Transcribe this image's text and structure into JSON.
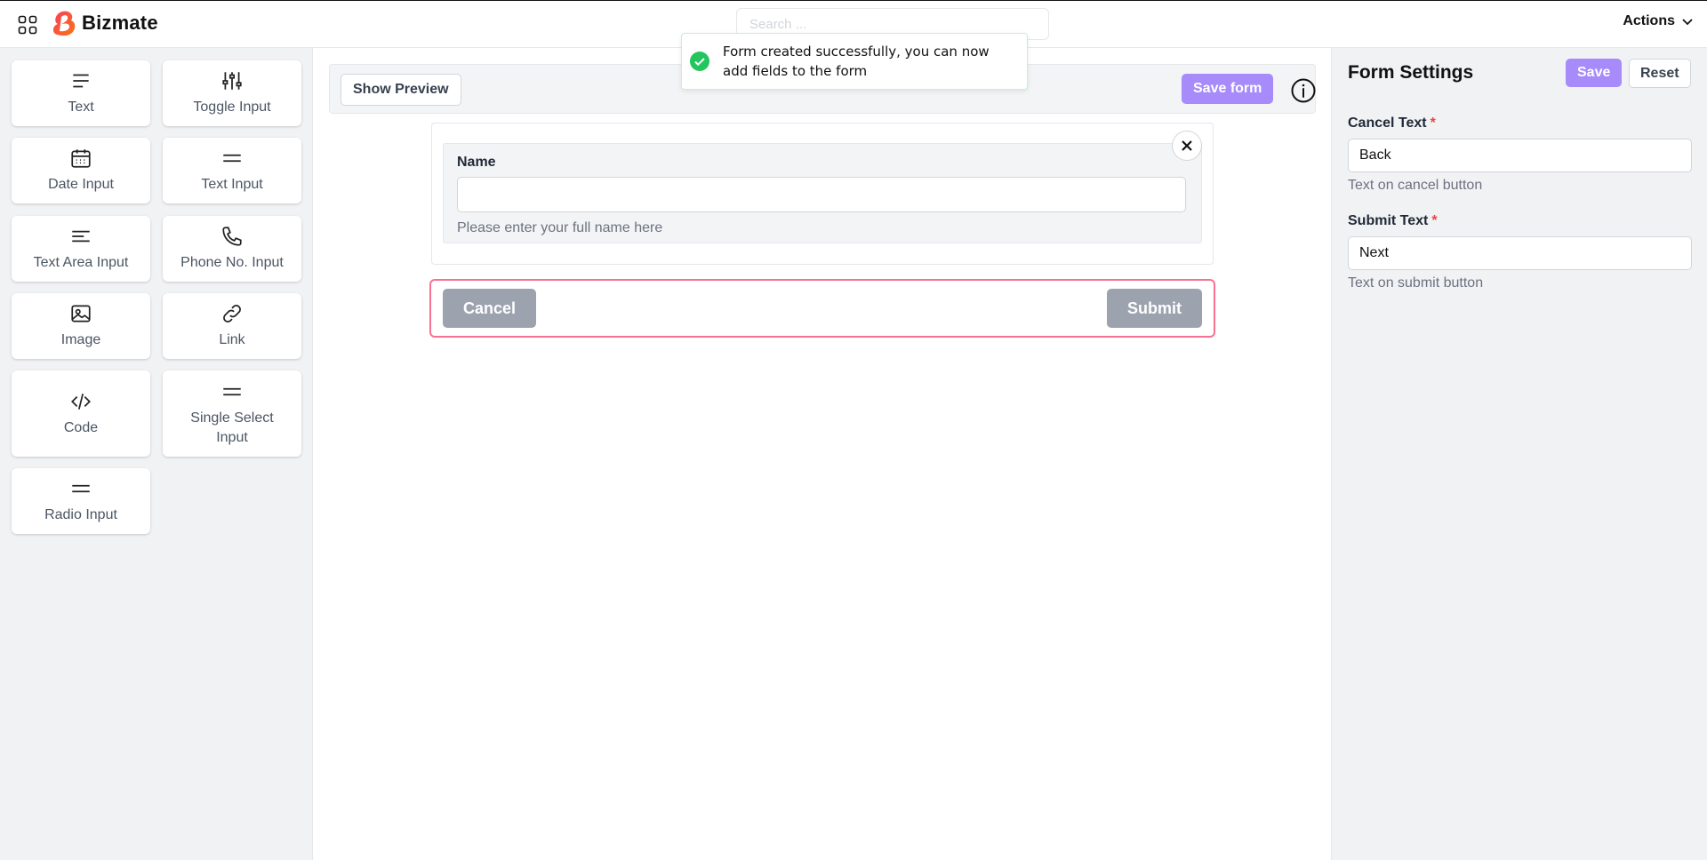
{
  "header": {
    "brand_name": "Bizmate",
    "search_placeholder": "Search ...",
    "actions_label": "Actions",
    "brand_color": "#f97316"
  },
  "palette": {
    "items": [
      {
        "label": "Text",
        "icon": "text-lines-icon"
      },
      {
        "label": "Toggle Input",
        "icon": "sliders-icon"
      },
      {
        "label": "Date Input",
        "icon": "calendar-icon"
      },
      {
        "label": "Text Input",
        "icon": "equals-lines-icon"
      },
      {
        "label": "Text Area Input",
        "icon": "align-left-icon"
      },
      {
        "label": "Phone No. Input",
        "icon": "phone-icon"
      },
      {
        "label": "Image",
        "icon": "image-icon"
      },
      {
        "label": "Link",
        "icon": "link-icon"
      },
      {
        "label": "Code",
        "icon": "code-icon"
      },
      {
        "label": "Single Select Input",
        "icon": "equals-lines-icon"
      },
      {
        "label": "Radio Input",
        "icon": "equals-lines-icon"
      }
    ]
  },
  "canvas": {
    "show_preview_label": "Show Preview",
    "save_form_label": "Save form",
    "field": {
      "label": "Name",
      "value": "",
      "help_text": "Please enter your full name here"
    },
    "cancel_label": "Cancel",
    "submit_label": "Submit",
    "accent_color": "#a78bfa",
    "selection_border_color": "#f87191"
  },
  "toast": {
    "message": "Form created successfully, you can now add fields to the form",
    "status_color": "#22c55e"
  },
  "settings": {
    "title": "Form Settings",
    "save_label": "Save",
    "reset_label": "Reset",
    "cancel_text_label": "Cancel Text",
    "cancel_text_value": "Back",
    "cancel_text_help": "Text on cancel button",
    "submit_text_label": "Submit Text",
    "submit_text_value": "Next",
    "submit_text_help": "Text on submit button",
    "required_marker": "*"
  }
}
